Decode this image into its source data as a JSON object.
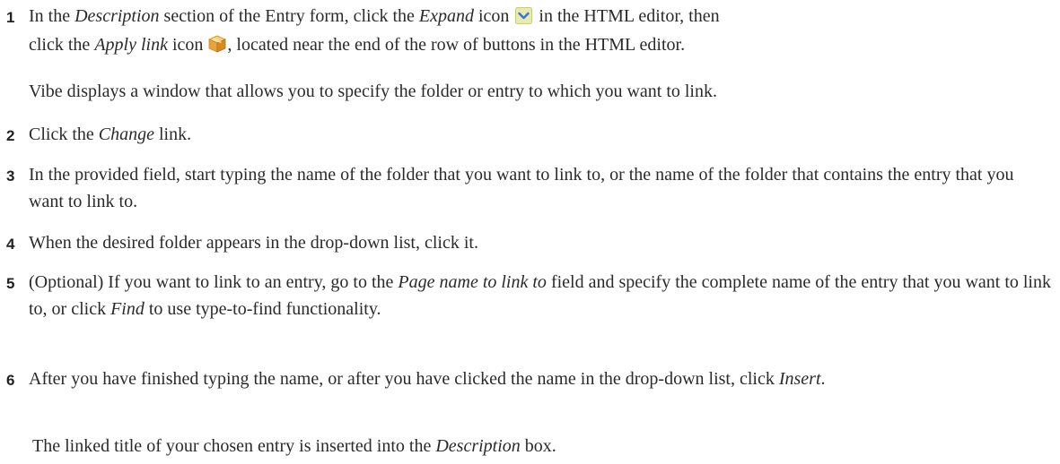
{
  "steps": [
    {
      "number": "1",
      "line1_a": "In the ",
      "line1_em1": "Description",
      "line1_b": " section of the Entry form, click the ",
      "line1_em2": "Expand",
      "line1_c": " icon",
      "line1_d": " in the HTML editor, then",
      "line2_a": "click the ",
      "line2_em": "Apply link",
      "line2_b": " icon",
      "line2_c": ", located near the end of the row of buttons in the HTML editor.",
      "note": "Vibe displays a window that allows you to specify the folder or entry to which you want to link."
    },
    {
      "number": "2",
      "a": "Click the ",
      "em": "Change",
      "b": " link."
    },
    {
      "number": "3",
      "text": "In the provided field, start typing the name of the folder that you want to link to, or the name of the folder that contains the entry that you want to link to."
    },
    {
      "number": "4",
      "text": "When the desired folder appears in the drop-down list, click it."
    },
    {
      "number": "5",
      "a": "(Optional) If you want to link to an entry, go to the ",
      "em1": "Page name to link to",
      "b": " field and specify the complete name of the entry that you want to link to, or click ",
      "em2": "Find",
      "c": " to use type-to-find functionality."
    },
    {
      "number": "6",
      "a": "After you have finished typing the name, or after you have clicked the name in the drop-down list, click ",
      "em": "Insert",
      "b": ".",
      "note_a": "The linked title of your chosen entry is inserted into the ",
      "note_em": "Description",
      "note_b": " box."
    }
  ],
  "icons": {
    "expand": "chevron-down-icon",
    "apply_link": "package-box-icon"
  },
  "colors": {
    "text": "#2a2a2a",
    "expand_icon_bg": "#e8e9b4",
    "expand_icon_chevron": "#3b76c4",
    "apply_icon_box": "#e6a33e"
  }
}
